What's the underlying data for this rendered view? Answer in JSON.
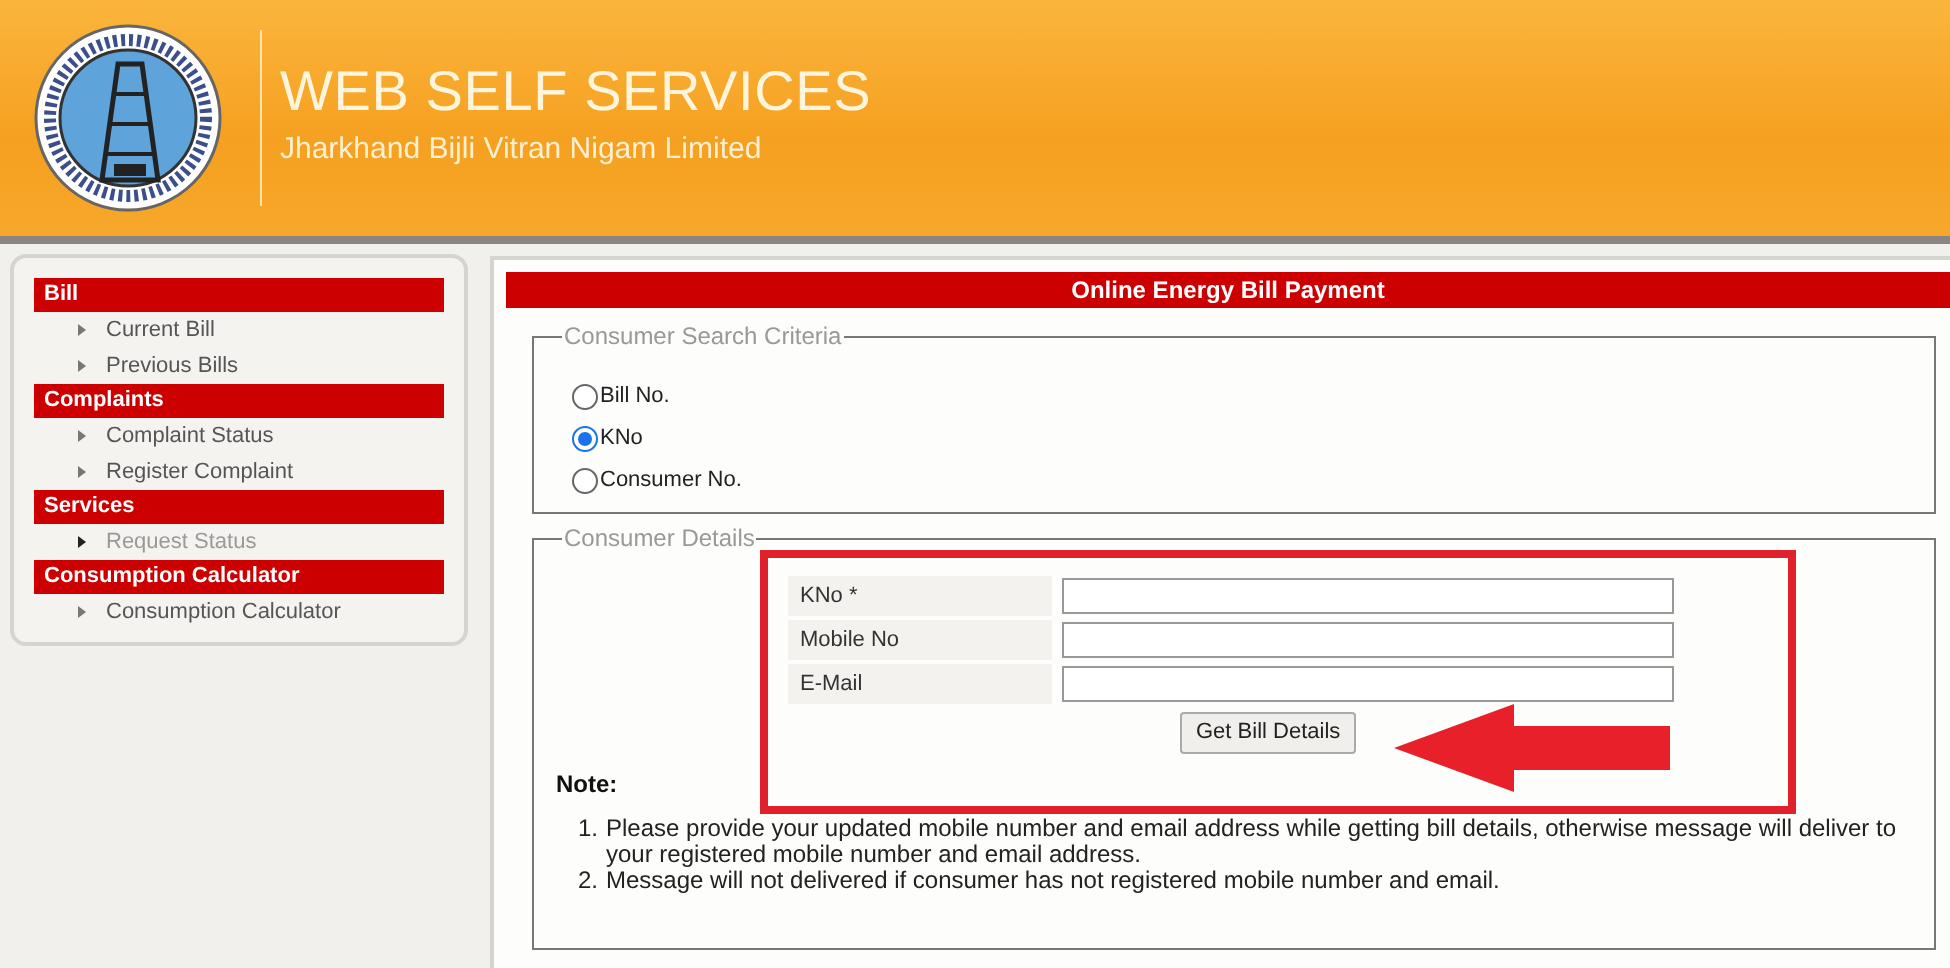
{
  "header": {
    "title": "WEB SELF SERVICES",
    "subtitle": "Jharkhand Bijli Vitran Nigam Limited"
  },
  "sidebar": {
    "groups": [
      {
        "heading": "Bill",
        "items": [
          {
            "label": "Current Bill",
            "disabled": false
          },
          {
            "label": "Previous Bills",
            "disabled": false
          }
        ]
      },
      {
        "heading": "Complaints",
        "items": [
          {
            "label": "Complaint Status",
            "disabled": false
          },
          {
            "label": "Register Complaint",
            "disabled": false
          }
        ]
      },
      {
        "heading": "Services",
        "items": [
          {
            "label": "Request Status",
            "disabled": true
          }
        ]
      },
      {
        "heading": "Consumption Calculator",
        "items": [
          {
            "label": "Consumption Calculator",
            "disabled": false
          }
        ]
      }
    ]
  },
  "main": {
    "title": "Online Energy Bill Payment",
    "search_criteria": {
      "legend": "Consumer Search Criteria",
      "options": [
        {
          "label": "Bill No.",
          "selected": false
        },
        {
          "label": "KNo",
          "selected": true
        },
        {
          "label": "Consumer No.",
          "selected": false
        }
      ]
    },
    "consumer_details": {
      "legend": "Consumer Details",
      "fields": [
        {
          "label": "KNo *"
        },
        {
          "label": "Mobile No"
        },
        {
          "label": "E-Mail"
        }
      ],
      "button": "Get Bill Details",
      "note_heading": "Note:",
      "notes": [
        {
          "number": "1.",
          "text": "Please provide your updated mobile number and email address while getting bill details, otherwise message will deliver to your registered mobile number and email address."
        },
        {
          "number": "2.",
          "text": "Message will not delivered if consumer has not registered mobile number and email."
        }
      ]
    }
  }
}
